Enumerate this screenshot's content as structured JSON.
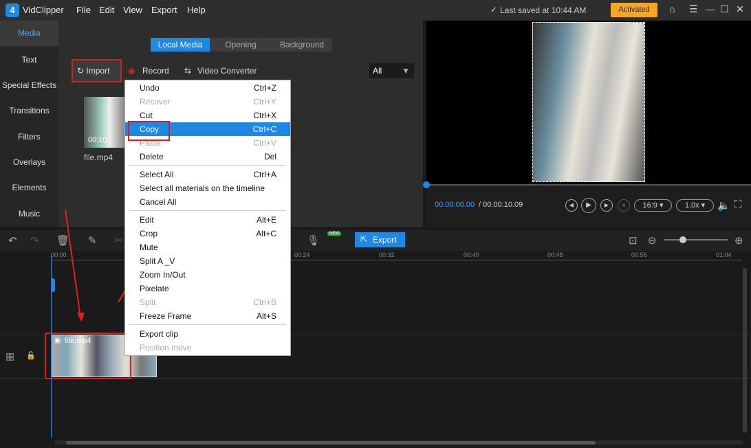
{
  "app": {
    "name": "VidClipper",
    "menu": [
      "File",
      "Edit",
      "View",
      "Export",
      "Help"
    ],
    "saved": "Last saved at 10:44 AM",
    "activated": "Activated"
  },
  "sidebar": {
    "items": [
      "Media",
      "Text",
      "Special Effects",
      "Transitions",
      "Filters",
      "Overlays",
      "Elements",
      "Music"
    ]
  },
  "media": {
    "tabs": [
      "Local Media",
      "Opening",
      "Background"
    ],
    "import": "Import",
    "record": "Record",
    "converter": "Video Converter",
    "filter": "All",
    "file": {
      "name": "file.mp4",
      "duration": "00:10"
    }
  },
  "preview": {
    "current": "00:00:00.00",
    "total": "/ 00:00:10.09",
    "ratio": "16:9",
    "speed": "1.0x"
  },
  "timeline": {
    "export": "Export",
    "new_badge": "NEW",
    "ticks": [
      "00:00",
      "00:24",
      "00:32",
      "00:40",
      "00:48",
      "00:56",
      "01:04"
    ],
    "clip": "file.mp4"
  },
  "context_menu": [
    {
      "label": "Undo",
      "shortcut": "Ctrl+Z"
    },
    {
      "label": "Recover",
      "shortcut": "Ctrl+Y",
      "disabled": true
    },
    {
      "label": "Cut",
      "shortcut": "Ctrl+X"
    },
    {
      "label": "Copy",
      "shortcut": "Ctrl+C",
      "highlighted": true
    },
    {
      "label": "Paste",
      "shortcut": "Ctrl+V",
      "disabled": true
    },
    {
      "label": "Delete",
      "shortcut": "Del"
    },
    {
      "label": "Select All",
      "shortcut": "Ctrl+A"
    },
    {
      "label": "Select all materials on the timeline",
      "shortcut": ""
    },
    {
      "label": "Cancel All",
      "shortcut": ""
    },
    {
      "label": "Edit",
      "shortcut": "Alt+E"
    },
    {
      "label": "Crop",
      "shortcut": "Alt+C"
    },
    {
      "label": "Mute",
      "shortcut": ""
    },
    {
      "label": "Split A _V",
      "shortcut": ""
    },
    {
      "label": "Zoom In/Out",
      "shortcut": ""
    },
    {
      "label": "Pixelate",
      "shortcut": ""
    },
    {
      "label": "Split",
      "shortcut": "Ctrl+B",
      "disabled": true
    },
    {
      "label": "Freeze Frame",
      "shortcut": "Alt+S"
    },
    {
      "label": "Export clip",
      "shortcut": ""
    },
    {
      "label": "Position move",
      "shortcut": "",
      "disabled": true
    }
  ],
  "colors": {
    "accent": "#1e88e5",
    "annotation": "#d02020",
    "activated": "#f5a623"
  }
}
